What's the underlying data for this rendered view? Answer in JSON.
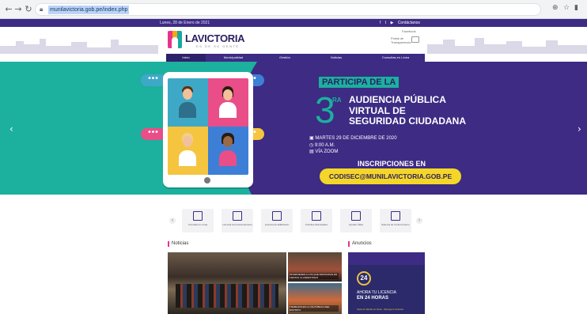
{
  "browser": {
    "back_icon": "arrow-left-icon",
    "url": "munilavictoria.gob.pe/index.php"
  },
  "topbar": {
    "date": "Lunes, 28 de Enero de 2021",
    "social_label": "Contáctanos"
  },
  "header": {
    "logo_name": "LAVICTORIA",
    "logo_tagline": "ES DE SU GENTE",
    "facebook_link": "Facebook",
    "transparency_label": "Portal de Transparencia"
  },
  "nav": {
    "items": [
      "Inicio",
      "Municipalidad",
      "Gestión",
      "Noticias",
      "Consultas en Línea"
    ]
  },
  "banner": {
    "bubble": "•••",
    "participa": "PARTICIPA DE LA",
    "ordinal": "3",
    "ordinal_suffix": "RA",
    "title_line1": "AUDIENCIA PÚBLICA",
    "title_line2": "VIRTUAL DE",
    "title_line3": "SEGURIDAD CIUDADANA",
    "date_line": "MARTES 29 DE DICIEMBRE DE 2020",
    "time_line": "9:00 A.M.",
    "via_line": "VÍA ZOOM",
    "inscripciones": "INSCRIPCIONES EN",
    "email": "CODISEC@MUNILAVICTORIA.GOB.PE",
    "prev_icon": "chevron-left-icon",
    "next_icon": "chevron-right-icon"
  },
  "services": [
    {
      "label": "Consulta en Línea"
    },
    {
      "label": "Licencia de Funcionamiento"
    },
    {
      "label": "Licencia de Edificación"
    },
    {
      "label": "Trámites Municipales"
    },
    {
      "label": "Ayudas Útiles"
    },
    {
      "label": "Sistema de Control Interno"
    }
  ],
  "sections": {
    "news": "Noticias",
    "ads": "Anuncios"
  },
  "news_side": [
    {
      "caption": "INTERVIENEN A LOS QUE PARTICIPAN EN FIESTAS CLANDESTINAS"
    },
    {
      "caption": "TRABAJOS EN LA VÍA PÚBLICA DEL DISTRITO"
    }
  ],
  "ad": {
    "badge": "24",
    "line1": "AHORA TU LICENCIA",
    "line2": "EN 24 HORAS",
    "line3": "Inicia el trámite en línea · Recoge tu licencia"
  },
  "colors": {
    "brand_purple": "#3d2b84",
    "teal": "#1cb09e",
    "yellow": "#f4d629",
    "pink": "#e8338b"
  }
}
